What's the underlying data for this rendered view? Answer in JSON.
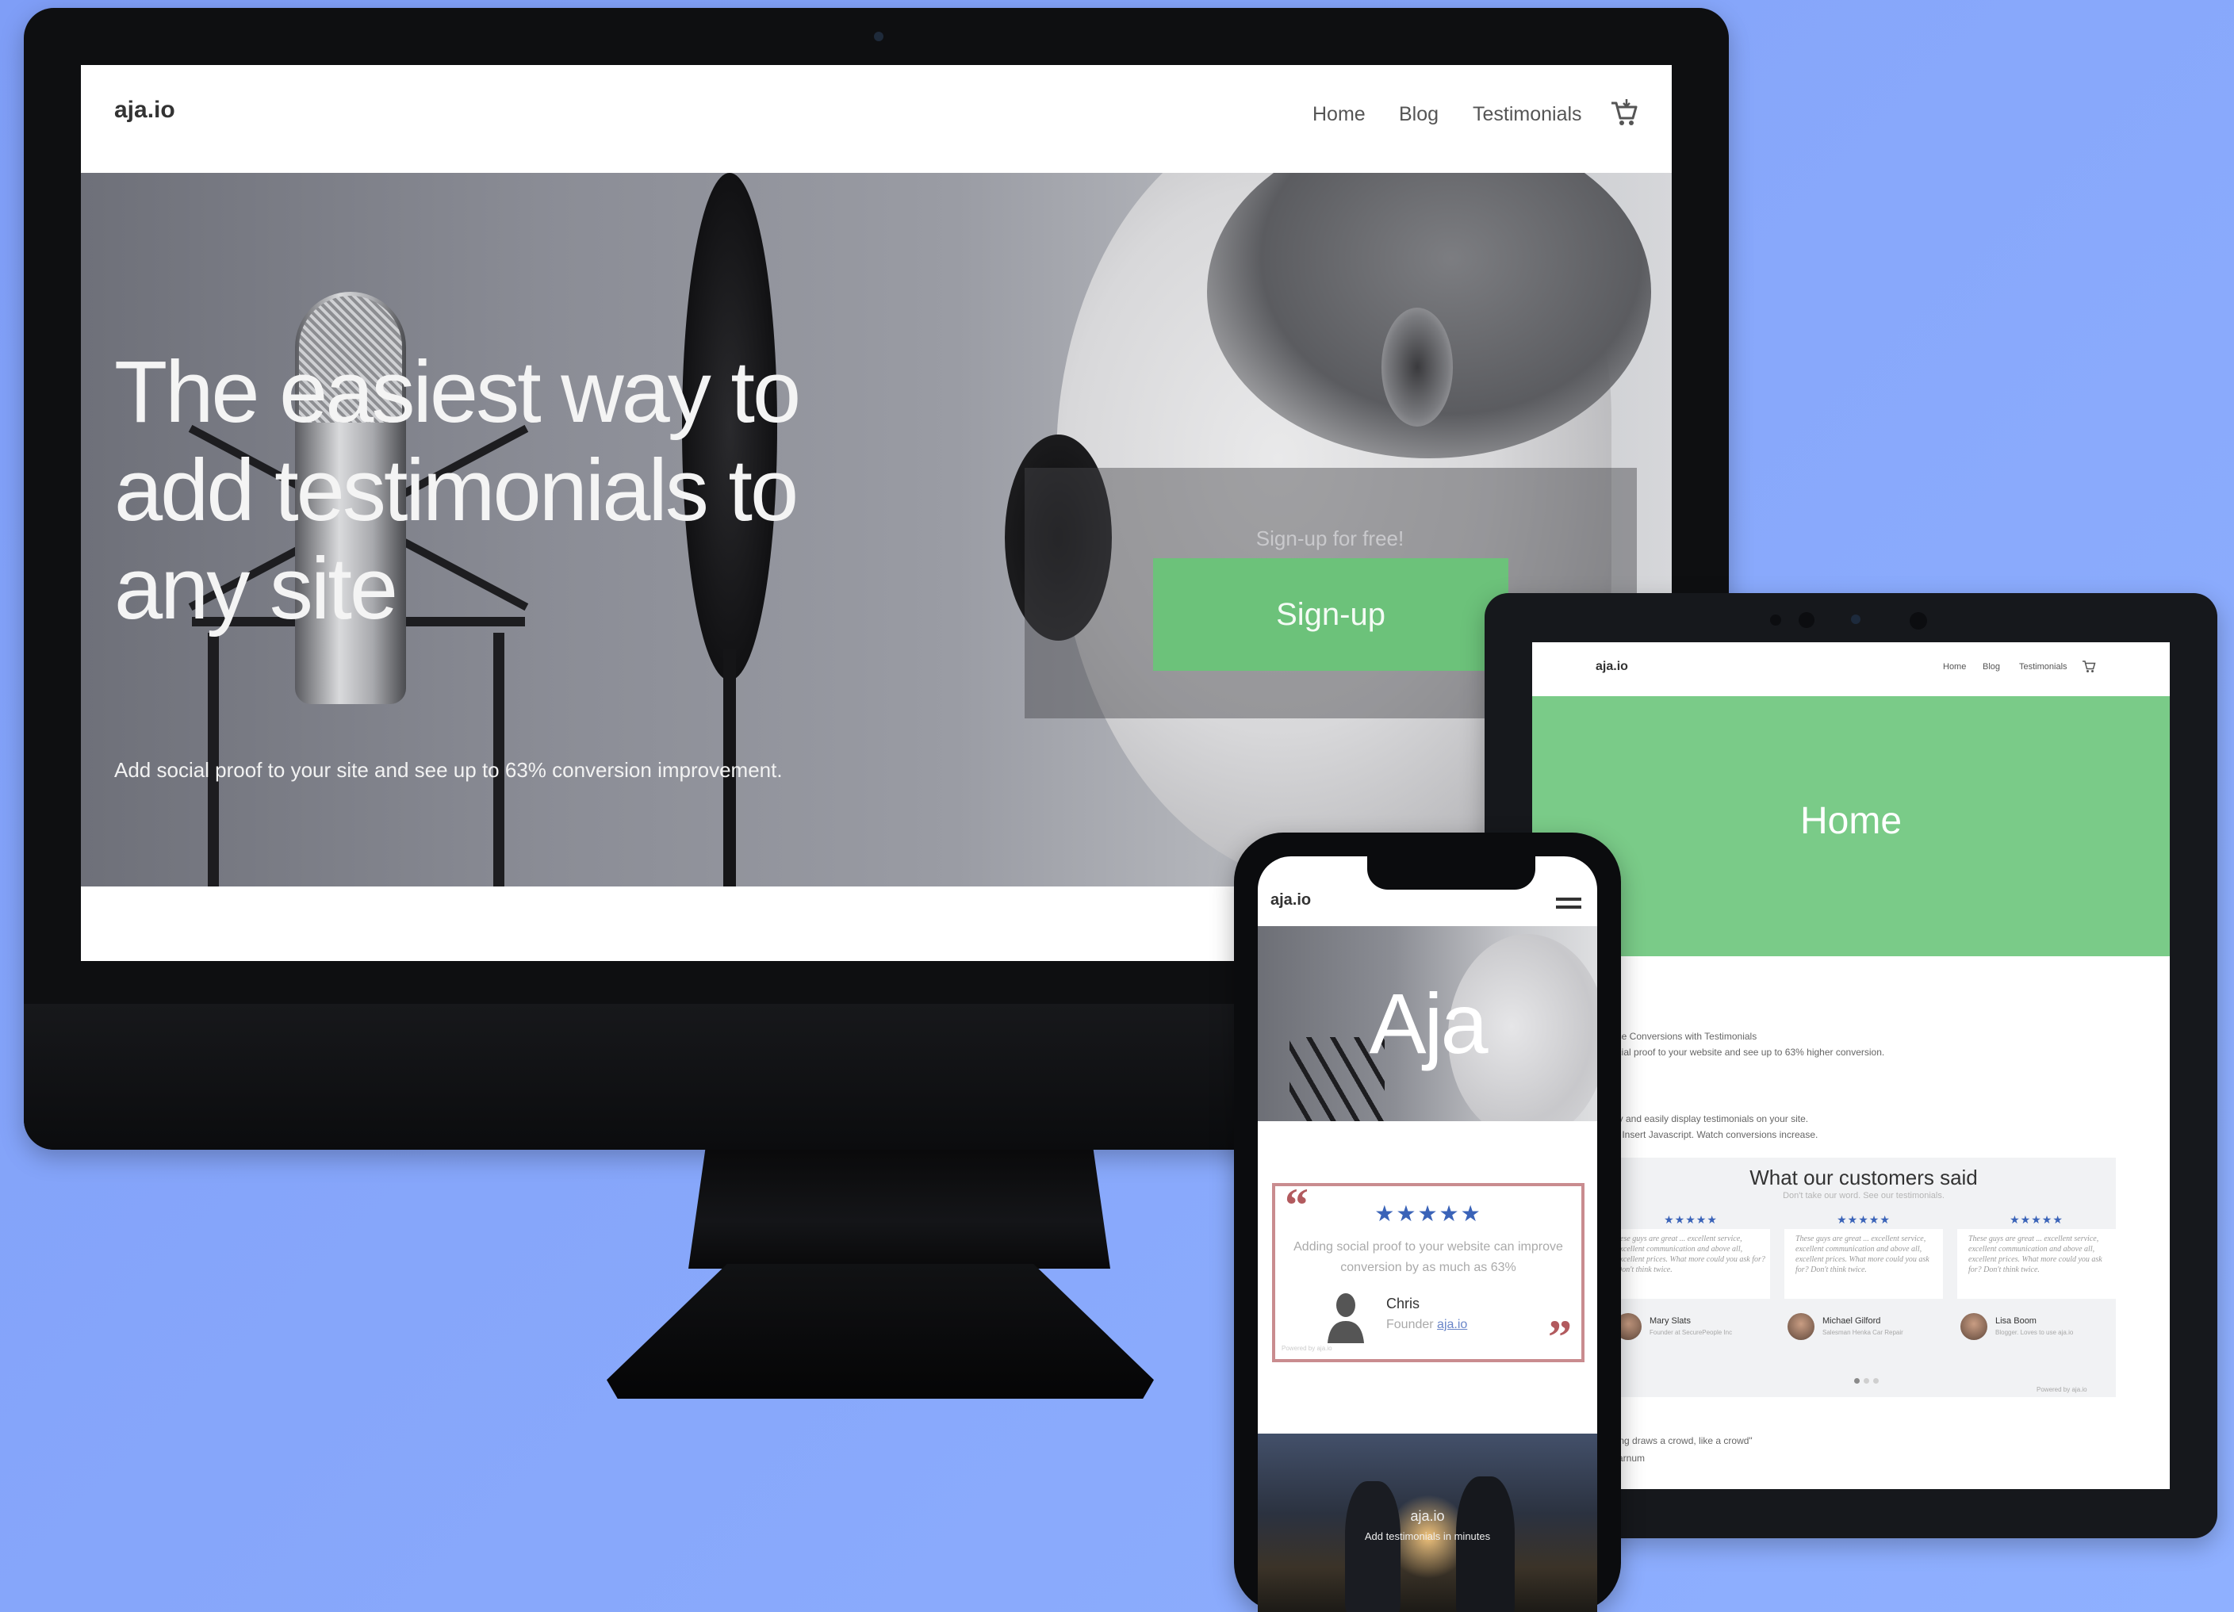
{
  "desktop": {
    "logo": "aja.io",
    "nav": [
      "Home",
      "Blog",
      "Testimonials"
    ],
    "hero": {
      "title_lines": [
        "The easiest way to",
        "add testimonials to",
        "any site"
      ],
      "subtitle": "Add social proof to your site and see up to 63% conversion improvement.",
      "signup_label": "Sign-up for free!",
      "signup_button": "Sign-up"
    }
  },
  "tablet": {
    "logo": "aja.io",
    "nav": [
      "Home",
      "Blog",
      "Testimonials"
    ],
    "hero_title": "Home",
    "section_lines": [
      "ase Conversions with Testimonials",
      "ocial proof to your website and see up to 63% higher conversion.",
      "kly and easily display testimonials on your site.",
      "p. Insert Javascript. Watch conversions increase."
    ],
    "widget": {
      "title": "What our customers said",
      "subtitle": "Don't take our word. See our testimonials.",
      "testimonials": [
        {
          "stars": "★★★★★",
          "quote": "hese guys are great ... excellent service, excellent communication and above all, excellent prices. What more could you ask for? Don't think twice.",
          "name": "Mary Slats",
          "role": "Founder at SecurePeople Inc"
        },
        {
          "stars": "★★★★★",
          "quote": "These guys are great ... excellent service, excellent communication and above all, excellent prices. What more could you ask for? Don't think twice.",
          "name": "Michael Gilford",
          "role": "Salesman Henka Car Repair"
        },
        {
          "stars": "★★★★★",
          "quote": "These guys are great ... excellent service, excellent communication and above all, excellent prices. What more could you ask for? Don't think twice.",
          "name": "Lisa Boom",
          "role": "Blogger. Loves to use aja.io"
        }
      ],
      "powered_by": "Powered by aja.io"
    },
    "footer_quote": "hing draws a crowd, like a crowd\"",
    "footer_author": "Barnum"
  },
  "phone": {
    "logo": "aja.io",
    "hero_title": "Aja",
    "testimonial": {
      "stars": "★★★★★",
      "quote": "Adding social proof to your website can improve conversion by as much as 63%",
      "name": "Chris",
      "role": "Founder",
      "role_link": "aja.io",
      "powered_by": "Powered by aja.io"
    },
    "photo_title": "aja.io",
    "photo_subtitle": "Add testimonials in minutes"
  },
  "colors": {
    "background": "#88a8fb",
    "accent_green": "#6cc27a",
    "tablet_hero_green": "#7acb88",
    "star_blue": "#3a63b8",
    "quote_red": "#b25a5e"
  },
  "icons": {
    "cart": "cart-icon",
    "menu": "hamburger-menu-icon"
  }
}
